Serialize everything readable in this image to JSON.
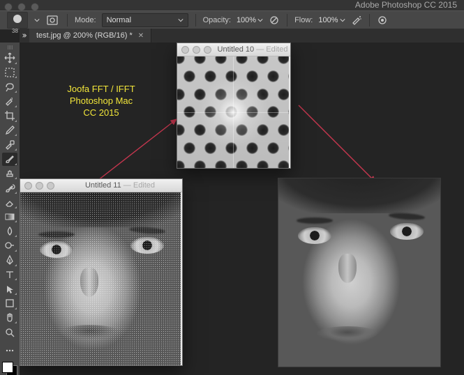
{
  "app_title": "Adobe Photoshop CC 2015",
  "options_bar": {
    "brush_size": "38",
    "mode_label": "Mode:",
    "mode_value": "Normal",
    "opacity_label": "Opacity:",
    "opacity_value": "100%",
    "flow_label": "Flow:",
    "flow_value": "100%"
  },
  "document_tab": {
    "title": "test.jpg @ 200% (RGB/16) *"
  },
  "annotation": {
    "line1": "Joofa FFT / IFFT",
    "line2": "Photoshop Mac",
    "line3": "CC 2015"
  },
  "windows": {
    "fft": {
      "title": "Untitled 10",
      "subtitle": "— Edited"
    },
    "src": {
      "title": "Untitled 11",
      "subtitle": "— Edited"
    }
  },
  "tools": [
    {
      "name": "move-tool",
      "label": "Move Tool"
    },
    {
      "name": "marquee-tool",
      "label": "Rectangular Marquee"
    },
    {
      "name": "lasso-tool",
      "label": "Lasso Tool"
    },
    {
      "name": "quick-select-tool",
      "label": "Quick Selection"
    },
    {
      "name": "crop-tool",
      "label": "Crop Tool"
    },
    {
      "name": "eyedropper-tool",
      "label": "Eyedropper"
    },
    {
      "name": "healing-brush-tool",
      "label": "Spot Healing Brush"
    },
    {
      "name": "brush-tool",
      "label": "Brush Tool",
      "selected": true
    },
    {
      "name": "clone-stamp-tool",
      "label": "Clone Stamp"
    },
    {
      "name": "history-brush-tool",
      "label": "History Brush"
    },
    {
      "name": "eraser-tool",
      "label": "Eraser"
    },
    {
      "name": "gradient-tool",
      "label": "Gradient Tool"
    },
    {
      "name": "blur-tool",
      "label": "Blur Tool"
    },
    {
      "name": "dodge-tool",
      "label": "Dodge Tool"
    },
    {
      "name": "pen-tool",
      "label": "Pen Tool"
    },
    {
      "name": "type-tool",
      "label": "Horizontal Type"
    },
    {
      "name": "path-select-tool",
      "label": "Path Selection"
    },
    {
      "name": "shape-tool",
      "label": "Rectangle Tool"
    },
    {
      "name": "hand-tool",
      "label": "Hand Tool"
    },
    {
      "name": "zoom-tool",
      "label": "Zoom Tool"
    }
  ]
}
